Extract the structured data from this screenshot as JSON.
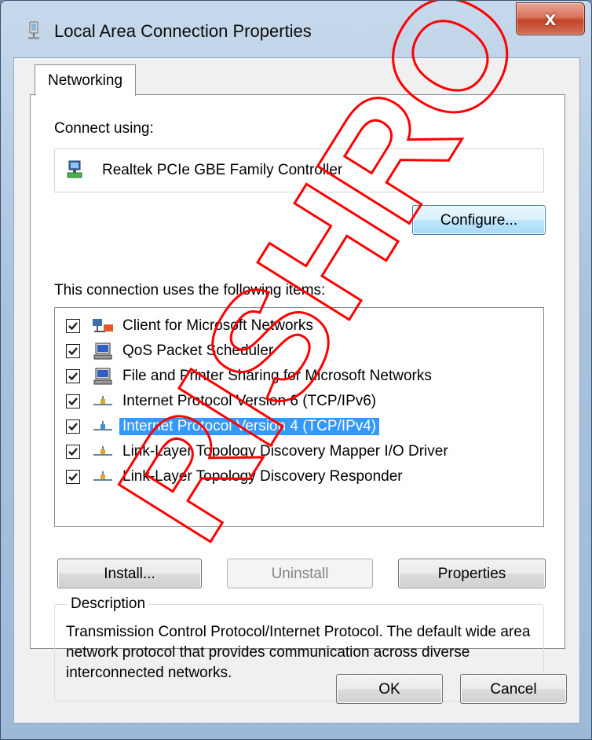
{
  "window": {
    "title": "Local Area Connection Properties",
    "close_glyph": "x",
    "icon": "network-connection-icon"
  },
  "tabs": [
    {
      "label": "Networking",
      "selected": true
    }
  ],
  "connect_using": {
    "label": "Connect using:",
    "adapter_name": "Realtek PCIe GBE Family Controller",
    "adapter_icon": "network-adapter-icon",
    "configure_label": "Configure..."
  },
  "items": {
    "label": "This connection uses the following items:",
    "list": [
      {
        "label": "Client for Microsoft Networks",
        "checked": true,
        "icon": "client-network-icon",
        "selected": false
      },
      {
        "label": "QoS Packet Scheduler",
        "checked": true,
        "icon": "service-monitor-icon",
        "selected": false
      },
      {
        "label": "File and Printer Sharing for Microsoft Networks",
        "checked": true,
        "icon": "service-monitor-icon",
        "selected": false
      },
      {
        "label": "Internet Protocol Version 6 (TCP/IPv6)",
        "checked": true,
        "icon": "protocol-icon",
        "selected": false
      },
      {
        "label": "Internet Protocol Version 4 (TCP/IPv4)",
        "checked": true,
        "icon": "protocol-icon",
        "selected": true
      },
      {
        "label": "Link-Layer Topology Discovery Mapper I/O Driver",
        "checked": true,
        "icon": "protocol-icon",
        "selected": false
      },
      {
        "label": "Link-Layer Topology Discovery Responder",
        "checked": true,
        "icon": "protocol-icon",
        "selected": false
      }
    ]
  },
  "buttons": {
    "install": "Install...",
    "uninstall": "Uninstall",
    "properties": "Properties",
    "ok": "OK",
    "cancel": "Cancel"
  },
  "description": {
    "legend": "Description",
    "text": "Transmission Control Protocol/Internet Protocol. The default wide area network protocol that provides communication across diverse interconnected networks."
  },
  "watermark": {
    "text": "RISHRO",
    "color": "#ff0000"
  },
  "colors": {
    "selection": "#3399ff",
    "close_button": "#c54327"
  }
}
